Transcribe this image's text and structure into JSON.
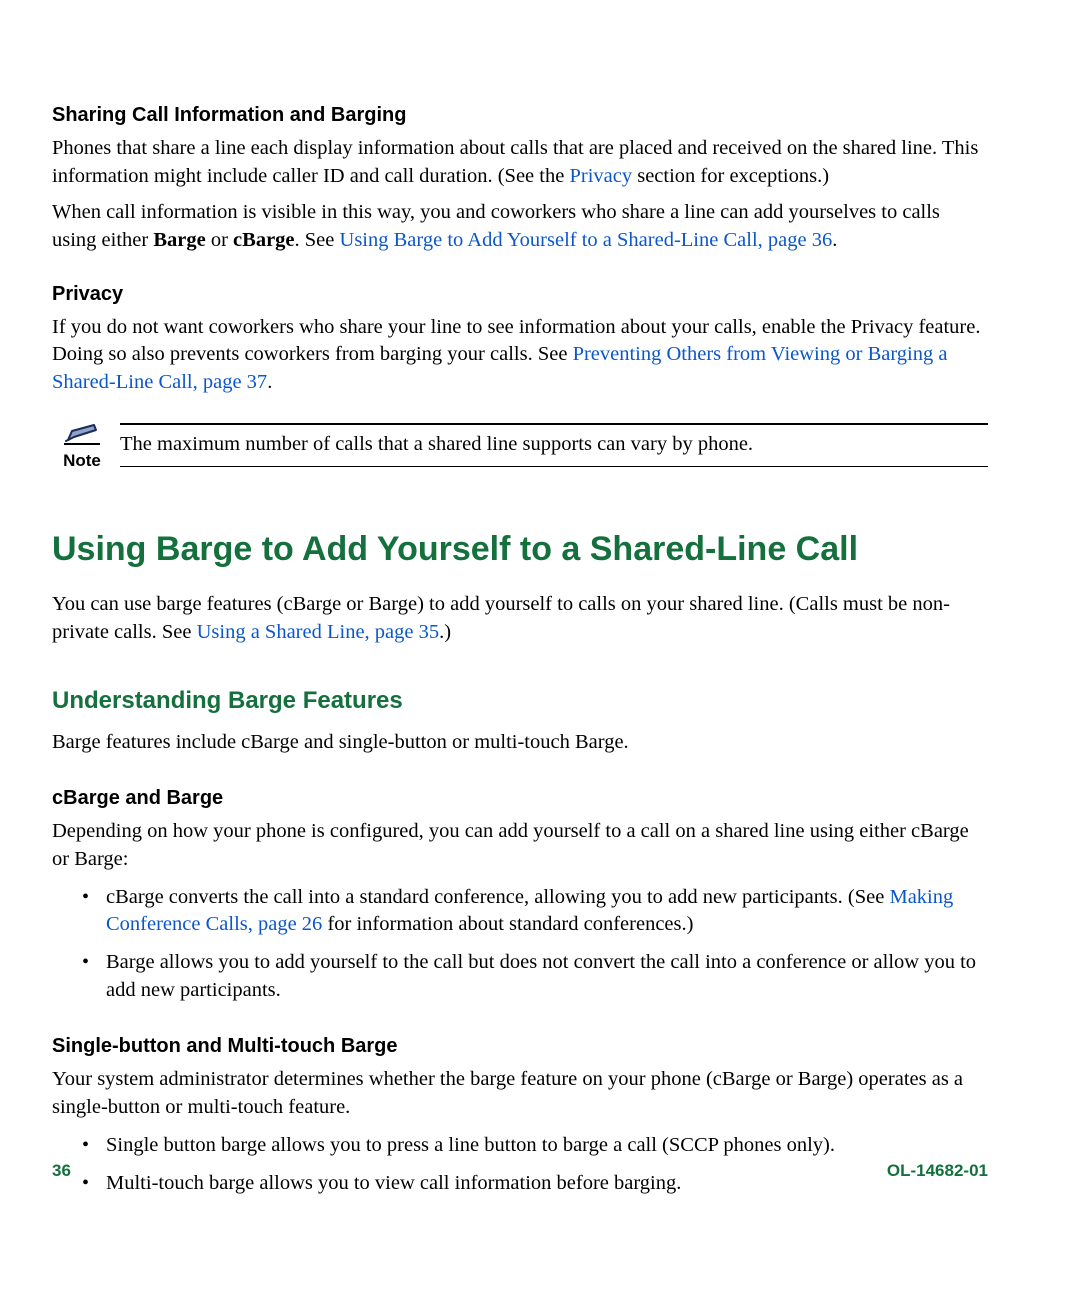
{
  "accent_green": "#14703d",
  "link_blue": "#0b57c9",
  "sec1": {
    "heading": "Sharing Call Information and Barging",
    "p1_pre_link": "Phones that share a line each display information about calls that are placed and received on the shared line. This information might include caller ID and call duration. (See the ",
    "p1_link": "Privacy",
    "p1_post_link": " section for exceptions.)",
    "p2_pre_bold": "When call information is visible in this way, you and coworkers who share a line can add yourselves to calls using either ",
    "p2_bold1": "Barge",
    "p2_mid": " or ",
    "p2_bold2": "cBarge",
    "p2_after_bold": ". See ",
    "p2_link": "Using Barge to Add Yourself to a Shared-Line Call, page 36",
    "p2_tail": "."
  },
  "sec2": {
    "heading": "Privacy",
    "p_pre_link": "If you do not want coworkers who share your line to see information about your calls, enable the Privacy feature. Doing so also prevents coworkers from barging your calls. See ",
    "p_link": "Preventing Others from Viewing or Barging a Shared-Line Call, page 37",
    "p_tail": "."
  },
  "note": {
    "label": "Note",
    "text": "The maximum number of calls that a shared line supports can vary by phone."
  },
  "h1": "Using Barge to Add Yourself to a Shared-Line Call",
  "intro": {
    "pre_link": "You can use barge features (cBarge or Barge) to add yourself to calls on your shared line. (Calls must be non-private calls. See ",
    "link": "Using a Shared Line, page 35",
    "tail": ".)"
  },
  "h2": "Understanding Barge Features",
  "h2_intro": "Barge features include cBarge and single-button or multi-touch Barge.",
  "sec3": {
    "heading": "cBarge and Barge",
    "intro": "Depending on how your phone is configured, you can add yourself to a call on a shared line using either cBarge or Barge:",
    "b1_pre": "cBarge converts the call into a standard conference, allowing you to add new participants. (See ",
    "b1_link": "Making Conference Calls, page 26",
    "b1_post": " for information about standard conferences.)",
    "b2": "Barge allows you to add yourself to the call but does not convert the call into a conference or allow you to add new participants."
  },
  "sec4": {
    "heading": "Single-button and Multi-touch Barge",
    "intro": "Your system administrator determines whether the barge feature on your phone (cBarge or Barge) operates as a single-button or multi-touch feature.",
    "b1": "Single button barge allows you to press a line button to barge a call (SCCP phones only).",
    "b2": "Multi-touch barge allows you to view call information before barging."
  },
  "footer": {
    "page": "36",
    "docid": "OL-14682-01"
  }
}
